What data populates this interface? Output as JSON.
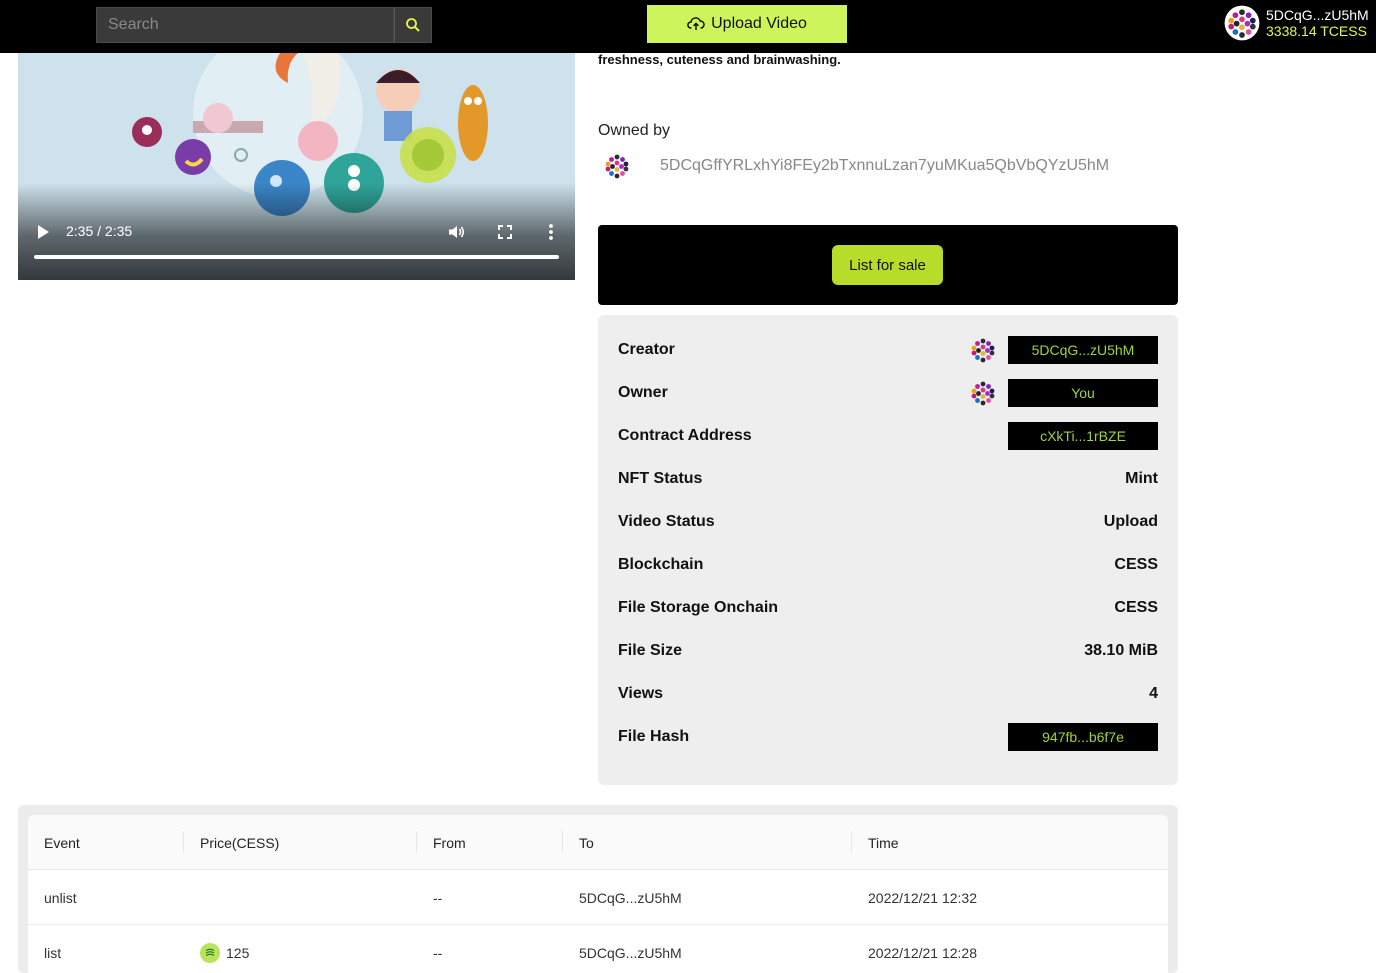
{
  "header": {
    "search_placeholder": "Search",
    "upload_label": "Upload Video",
    "account_name": "5DCqG...zU5hM",
    "account_balance": "3338.14 TCESS"
  },
  "video": {
    "time_display": "2:35 / 2:35",
    "progress_fraction": 1.0
  },
  "description_tail": "freshness, cuteness and brainwashing.",
  "owned": {
    "label": "Owned by",
    "address": "5DCqGffYRLxhYi8FEy2bTxnnuLzan7yuMKua5QbVbQYzU5hM"
  },
  "sale": {
    "button_label": "List for sale"
  },
  "details": {
    "creator_label": "Creator",
    "creator_value": "5DCqG...zU5hM",
    "owner_label": "Owner",
    "owner_value": "You",
    "contract_label": "Contract Address",
    "contract_value": "cXkTi...1rBZE",
    "nft_status_label": "NFT Status",
    "nft_status_value": "Mint",
    "video_status_label": "Video Status",
    "video_status_value": "Upload",
    "blockchain_label": "Blockchain",
    "blockchain_value": "CESS",
    "storage_label": "File Storage Onchain",
    "storage_value": "CESS",
    "size_label": "File Size",
    "size_value": "38.10 MiB",
    "views_label": "Views",
    "views_value": "4",
    "hash_label": "File Hash",
    "hash_value": "947fb...b6f7e"
  },
  "events": {
    "columns": [
      "Event",
      "Price(CESS)",
      "From",
      "To",
      "Time"
    ],
    "rows": [
      {
        "event": "unlist",
        "price": "",
        "from": "--",
        "to": "5DCqG...zU5hM",
        "time": "2022/12/21 12:32"
      },
      {
        "event": "list",
        "price": "125",
        "from": "--",
        "to": "5DCqG...zU5hM",
        "time": "2022/12/21 12:28"
      }
    ]
  },
  "colors": {
    "accent": "#cdf45a",
    "sale_button": "#b7dc2a",
    "chip_text": "#9ed43a",
    "balance": "#e6f34a"
  }
}
